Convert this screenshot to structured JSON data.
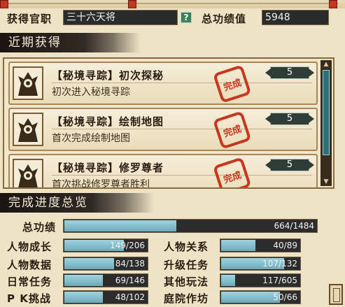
{
  "header": {
    "rank_label": "获得官职",
    "rank_value": "三十六天将",
    "help_icon": "?",
    "score_label": "总功绩值",
    "score_value": "5948"
  },
  "recent": {
    "title": "近期获得",
    "items": [
      {
        "title": "【秘境寻踪】初次探秘",
        "desc": "初次进入秘境寻踪",
        "points": "5",
        "stamp": "完成"
      },
      {
        "title": "【秘境寻踪】绘制地图",
        "desc": "首次完成绘制地图",
        "points": "5",
        "stamp": "完成"
      },
      {
        "title": "【秘境寻踪】修罗尊者",
        "desc": "首次挑战修罗尊者胜利",
        "points": "5",
        "stamp": "完成"
      }
    ]
  },
  "overview": {
    "title": "完成进度总览",
    "total": {
      "label": "总功绩",
      "value": "664/1484",
      "fraction": 0.447
    },
    "rows": [
      {
        "left": {
          "label": "人物成长",
          "value": "149/206",
          "fraction": 0.723
        },
        "right": {
          "label": "人物关系",
          "value": "40/89",
          "fraction": 0.449
        }
      },
      {
        "left": {
          "label": "人物数据",
          "value": "84/138",
          "fraction": 0.609
        },
        "right": {
          "label": "升级任务",
          "value": "107/132",
          "fraction": 0.811
        }
      },
      {
        "left": {
          "label": "日常任务",
          "value": "69/146",
          "fraction": 0.473
        },
        "right": {
          "label": "其他玩法",
          "value": "117/605",
          "fraction": 0.193
        }
      },
      {
        "left": {
          "label": "P K挑战",
          "value": "48/102",
          "fraction": 0.471
        },
        "right": {
          "label": "庭院作坊",
          "value": "50/66",
          "fraction": 0.758
        }
      }
    ]
  },
  "colors": {
    "bar_fill": "#9ed3e0",
    "stamp_red": "#c8361f",
    "banner_dark": "#1a1510"
  }
}
